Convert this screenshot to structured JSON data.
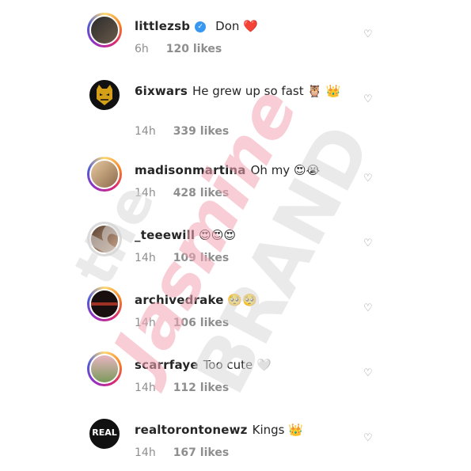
{
  "comments": [
    {
      "username": "littlezsb",
      "verified": true,
      "text": "Don",
      "emoji": "❤️",
      "time": "6h",
      "likes": "120 likes",
      "avatar_icon": "avatar-photo-icon",
      "ring": "gradient"
    },
    {
      "username": "6ixwars",
      "verified": false,
      "text": "He grew up so fast",
      "emoji": "🦉 👑",
      "time": "14h",
      "likes": "339 likes",
      "avatar_icon": "mask-avatar-icon",
      "ring": "none"
    },
    {
      "username": "madisonmartina",
      "verified": false,
      "text": "Oh my",
      "emoji": "😍😭",
      "time": "14h",
      "likes": "428 likes",
      "avatar_icon": "avatar-photo-icon",
      "ring": "gradient"
    },
    {
      "username": "_teeewill",
      "verified": false,
      "text": "",
      "emoji": "😍😍😍",
      "time": "14h",
      "likes": "109 likes",
      "avatar_icon": "avatar-photo-icon",
      "ring": "plain"
    },
    {
      "username": "archivedrake",
      "verified": false,
      "text": "",
      "emoji": "🥺🥺",
      "time": "14h",
      "likes": "106 likes",
      "avatar_icon": "avatar-photo-icon",
      "ring": "gradient"
    },
    {
      "username": "scarrfaye",
      "verified": false,
      "text": "Too cute",
      "emoji": "🤍",
      "time": "14h",
      "likes": "112 likes",
      "avatar_icon": "avatar-photo-icon",
      "ring": "gradient"
    },
    {
      "username": "realtorontonewz",
      "verified": false,
      "text": "Kings",
      "emoji": "👑",
      "time": "14h",
      "likes": "167 likes",
      "avatar_icon": "real-toronto-news-logo-icon",
      "ring": "none",
      "avatar_text": "REAL"
    }
  ],
  "watermark": {
    "line1": "the",
    "line2": "Jasmine",
    "line3": "BRAND"
  },
  "colors": {
    "text": "#262626",
    "meta": "#8e8e8e",
    "verified": "#3897f0",
    "watermark_pink": "#f4a6b5",
    "watermark_gray": "#d9d9d9"
  }
}
